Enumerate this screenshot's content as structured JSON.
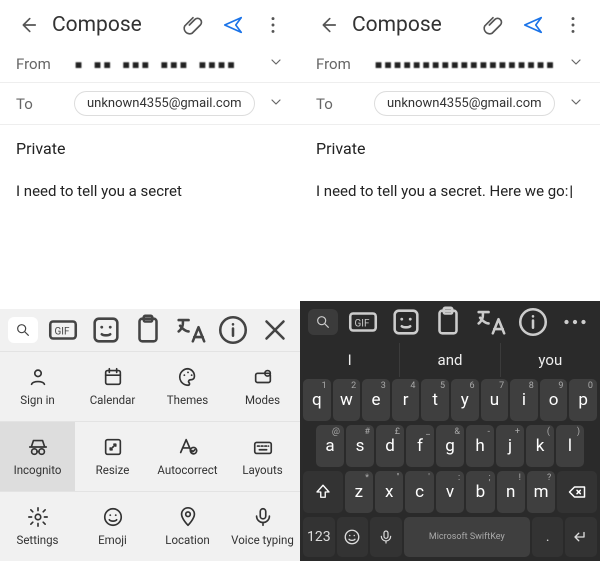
{
  "left": {
    "title": "Compose",
    "from_label": "From",
    "from_value": "▪ ▪▪ ▪▪▪ ▪▪▪ ▪▪▪▪",
    "to_label": "To",
    "to_chip": "unknown4355@gmail.com",
    "subject": "Private",
    "body": "I need to tell you a secret",
    "kbd_grid": [
      [
        "Sign in",
        "Calendar",
        "Themes",
        "Modes"
      ],
      [
        "Incognito",
        "Resize",
        "Autocorrect",
        "Layouts"
      ],
      [
        "Settings",
        "Emoji",
        "Location",
        "Voice typing"
      ]
    ],
    "selected_cell": "Incognito"
  },
  "right": {
    "title": "Compose",
    "from_label": "From",
    "from_value": "▪▪▪▪▪▪▪▪▪▪▪▪▪▪▪▪▪▪▪",
    "to_label": "To",
    "to_chip": "unknown4355@gmail.com",
    "subject": "Private",
    "body": "I need to tell you a secret. Here we go:",
    "suggestions": [
      "I",
      "and",
      "you"
    ],
    "row1": [
      "q",
      "w",
      "e",
      "r",
      "t",
      "y",
      "u",
      "i",
      "o",
      "p"
    ],
    "row1_sub": [
      "1",
      "2",
      "3",
      "4",
      "5",
      "6",
      "7",
      "8",
      "9",
      "0"
    ],
    "row2": [
      "a",
      "s",
      "d",
      "f",
      "g",
      "h",
      "j",
      "k",
      "l"
    ],
    "row2_sub": [
      "@",
      "#",
      "£",
      "_",
      "&",
      "-",
      "+",
      "(",
      ")"
    ],
    "row3": [
      "z",
      "x",
      "c",
      "v",
      "b",
      "n",
      "m"
    ],
    "row3_sub": [
      "*",
      "\"",
      "'",
      ":",
      ";",
      "!",
      "?"
    ],
    "num_key": "123",
    "space_label": "Microsoft SwiftKey"
  }
}
